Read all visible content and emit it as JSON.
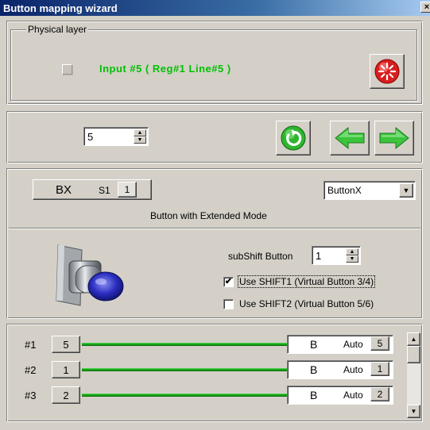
{
  "window": {
    "title": "Button mapping wizard",
    "close_glyph": "×"
  },
  "physical": {
    "legend": "Physical layer",
    "input_text": "Input #5  ( Reg#1  Line#5 )"
  },
  "nav": {
    "spin_value": "5"
  },
  "button": {
    "bx_label": "BX",
    "s_label": "S1",
    "s_value": "1",
    "type_selected": "ButtonX",
    "description": "Button  with Extended Mode",
    "subshift_label": "subShift Button",
    "subshift_value": "1",
    "shift1_label": "Use SHIFT1 (Virtual Button 3/4)",
    "shift1_checked": true,
    "shift2_label": "Use SHIFT2 (Virtual Button 5/6)",
    "shift2_checked": false
  },
  "mapping": {
    "rows": [
      {
        "label": "#1",
        "source": "5",
        "target": "B",
        "mode": "Auto",
        "mode_value": "5"
      },
      {
        "label": "#2",
        "source": "1",
        "target": "B",
        "mode": "Auto",
        "mode_value": "1"
      },
      {
        "label": "#3",
        "source": "2",
        "target": "B",
        "mode": "Auto",
        "mode_value": "2"
      }
    ]
  },
  "colors": {
    "green_text": "#00c000",
    "line_green": "#19a319",
    "title_blue": "#0a246a"
  }
}
